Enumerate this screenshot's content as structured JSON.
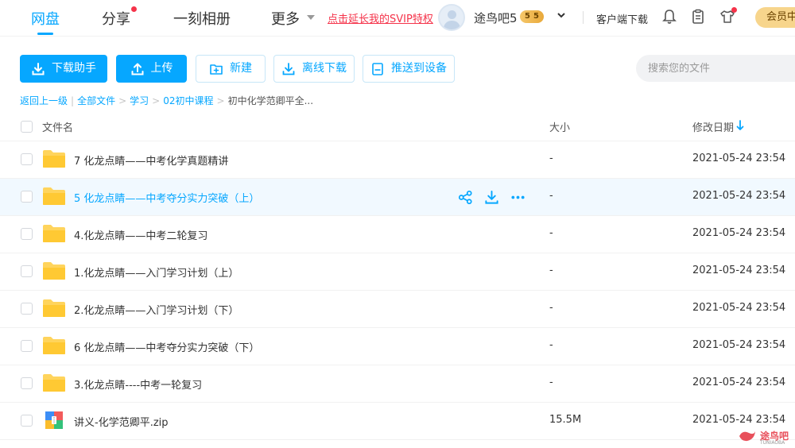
{
  "nav": {
    "tabs": [
      {
        "label": "网盘"
      },
      {
        "label": "分享"
      },
      {
        "label": "一刻相册"
      },
      {
        "label": "更多"
      }
    ],
    "svip_link": "点击延长我的SVIP特权",
    "username": "途鸟吧5",
    "level_badge": [
      "5",
      "5"
    ],
    "client_download": "客户端下载",
    "vip_button": "会员中"
  },
  "toolbar": {
    "download_helper": "下载助手",
    "upload": "上传",
    "new": "新建",
    "offline_download": "离线下载",
    "push_device": "推送到设备",
    "search_placeholder": "搜索您的文件"
  },
  "breadcrumb": {
    "back": "返回上一级",
    "items": [
      "全部文件",
      "学习",
      "02初中课程"
    ],
    "current": "初中化学范卿平全..."
  },
  "table": {
    "headers": {
      "name": "文件名",
      "size": "大小",
      "date": "修改日期"
    },
    "rows": [
      {
        "name": "7 化龙点睛——中考化学真题精讲",
        "size": "-",
        "date": "2021-05-24 23:54",
        "type": "folder"
      },
      {
        "name": "5 化龙点睛——中考夺分实力突破（上）",
        "size": "-",
        "date": "2021-05-24 23:54",
        "type": "folder"
      },
      {
        "name": "4.化龙点睛——中考二轮复习",
        "size": "-",
        "date": "2021-05-24 23:54",
        "type": "folder"
      },
      {
        "name": "1.化龙点睛——入门学习计划（上）",
        "size": "-",
        "date": "2021-05-24 23:54",
        "type": "folder"
      },
      {
        "name": "2.化龙点睛——入门学习计划（下）",
        "size": "-",
        "date": "2021-05-24 23:54",
        "type": "folder"
      },
      {
        "name": "6 化龙点睛——中考夺分实力突破（下）",
        "size": "-",
        "date": "2021-05-24 23:54",
        "type": "folder"
      },
      {
        "name": "3.化龙点睛----中考一轮复习",
        "size": "-",
        "date": "2021-05-24 23:54",
        "type": "folder"
      },
      {
        "name": "讲义-化学范卿平.zip",
        "size": "15.5M",
        "date": "2021-05-24 23:54",
        "type": "zip"
      }
    ]
  },
  "watermark": {
    "main": "途鸟吧",
    "sub": "TUNIAOBA"
  },
  "colors": {
    "accent": "#06a7ff",
    "alert": "#f5334a",
    "folder": "#ffd45c"
  }
}
